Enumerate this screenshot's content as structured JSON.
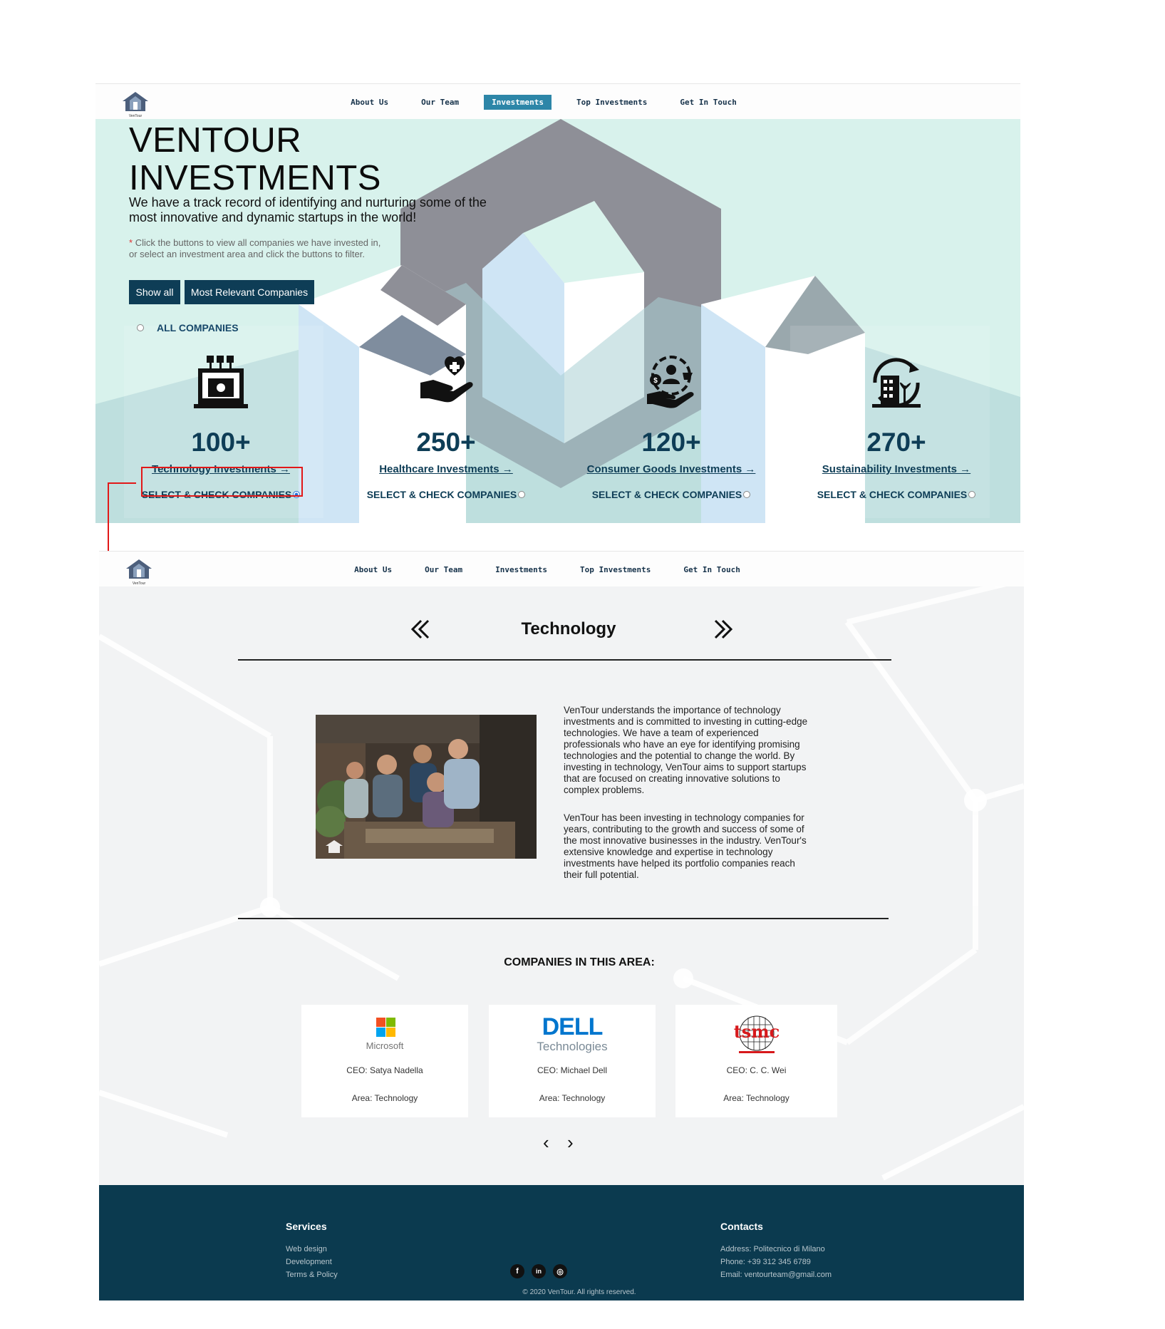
{
  "nav": {
    "items": [
      {
        "label": "About Us"
      },
      {
        "label": "Our Team"
      },
      {
        "label": "Investments"
      },
      {
        "label": "Top Investments"
      },
      {
        "label": "Get In Touch"
      }
    ],
    "active": "Investments"
  },
  "hero": {
    "title_line1": "VENTOUR",
    "title_line2": "INVESTMENTS",
    "subtitle": "We have a track record of identifying and nurturing some of the most innovative and dynamic startups in the world!",
    "note_star": "*",
    "note": "Click the buttons to view all companies we have invested in, or select an investment area and click the buttons to filter.",
    "show_all": "Show all",
    "most_relevant": "Most Relevant Companies",
    "all_companies": "ALL COMPANIES",
    "categories": [
      {
        "count": "100+",
        "link": "Technology Investments →",
        "select": "SELECT & CHECK COMPANIES",
        "icon": "technology-icon",
        "selected": true
      },
      {
        "count": "250+",
        "link": "Healthcare Investments →",
        "select": "SELECT & CHECK COMPANIES",
        "icon": "healthcare-icon",
        "selected": false
      },
      {
        "count": "120+",
        "link": "Consumer Goods Investments →",
        "select": "SELECT & CHECK COMPANIES",
        "icon": "consumer-goods-icon",
        "selected": false
      },
      {
        "count": "270+",
        "link": "Sustainability Investments →",
        "select": "SELECT & CHECK COMPANIES",
        "icon": "sustainability-icon",
        "selected": false
      }
    ]
  },
  "detail": {
    "title": "Technology",
    "para1": "VenTour understands the importance of technology investments and is committed to investing in cutting-edge technologies. We have a team of experienced professionals who have an eye for identifying promising technologies and the potential to change the world. By investing in technology, VenTour aims to support startups that are focused on creating innovative solutions to complex problems.",
    "para2": "VenTour has been investing in technology companies for years, contributing to the growth and success of some of the most innovative businesses in the industry. VenTour's extensive knowledge and expertise in technology investments have helped its portfolio companies reach their full potential.",
    "companies_title": "COMPANIES IN THIS AREA:",
    "companies": [
      {
        "name": "Microsoft",
        "ceo": "CEO: Satya Nadella",
        "area": "Area: Technology"
      },
      {
        "name": "DELL Technologies",
        "ceo": "CEO: Michael Dell",
        "area": "Area: Technology"
      },
      {
        "name": "tsmc",
        "ceo": "CEO: C. C. Wei",
        "area": "Area: Technology"
      }
    ],
    "pager_prev": "‹",
    "pager_next": "›"
  },
  "footer": {
    "services_title": "Services",
    "services": [
      "Web design",
      "Development",
      "Terms & Policy"
    ],
    "contacts_title": "Contacts",
    "contacts": [
      "Address: Politecnico di Milano",
      "Phone: +39 312 345 6789",
      "Email: ventourteam@gmail.com"
    ],
    "social": [
      "f",
      "in",
      "◎"
    ],
    "copyright": "© 2020 VenTour. All rights reserved."
  },
  "colors": {
    "primary": "#0e3d56",
    "hero_bg": "#d8f2ec",
    "active_nav": "#2d86a8",
    "highlight": "#e21818",
    "footer": "#0b3a4f"
  }
}
